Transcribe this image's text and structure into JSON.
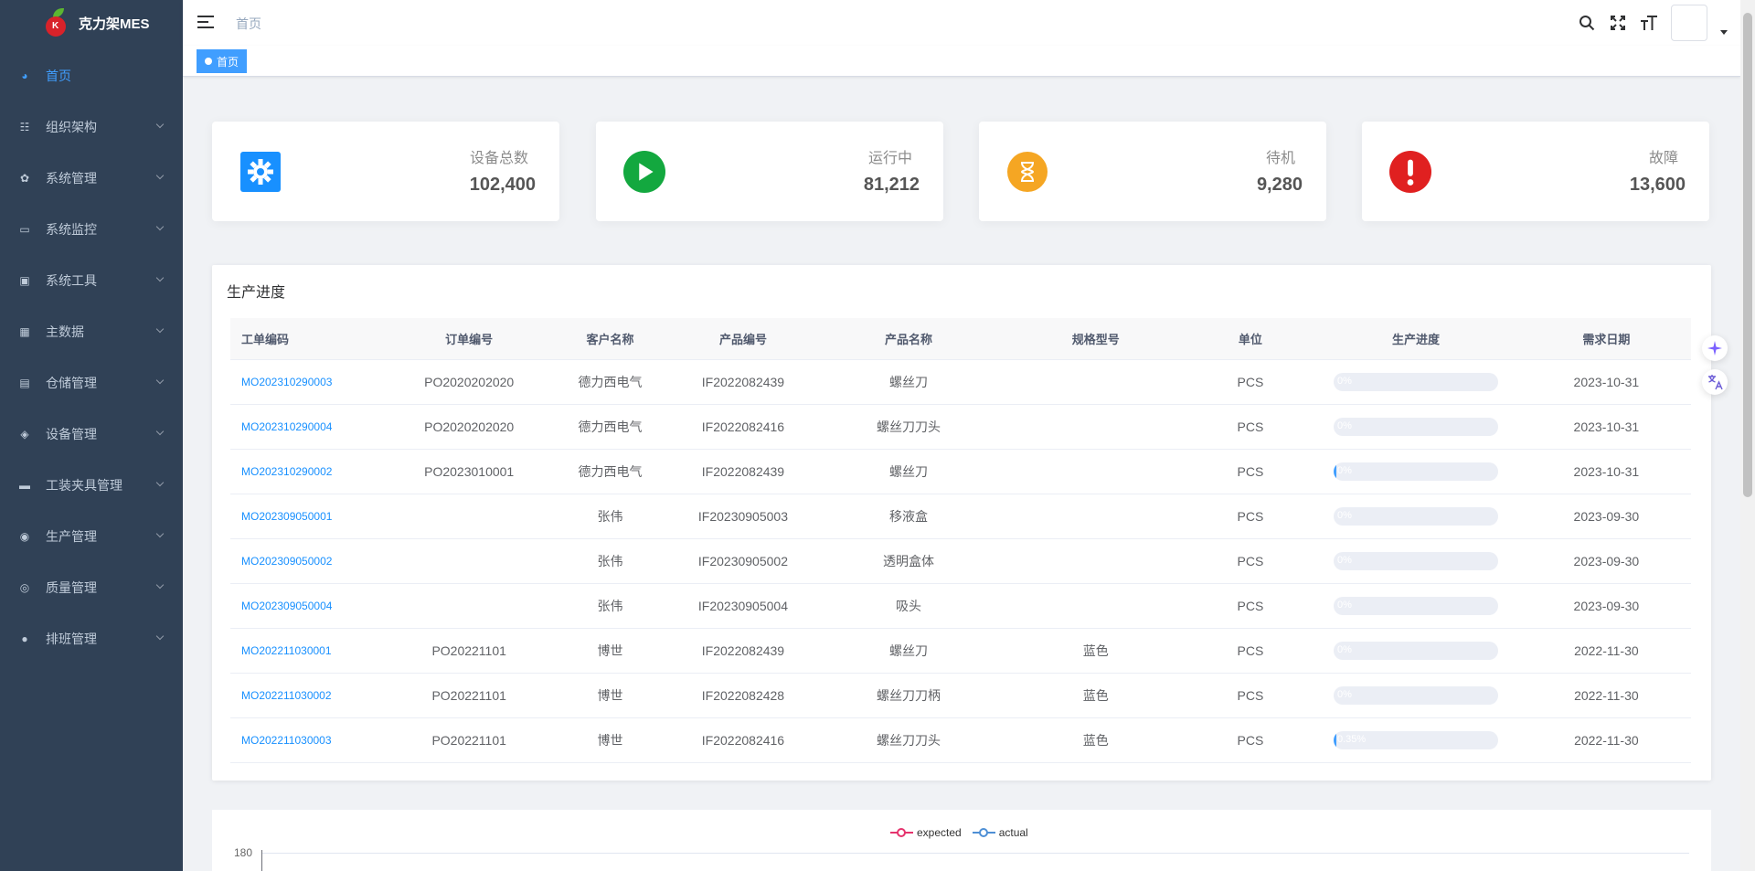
{
  "app": {
    "title": "克力架MES"
  },
  "sidebar": {
    "items": [
      {
        "label": "首页",
        "active": true
      },
      {
        "label": "组织架构"
      },
      {
        "label": "系统管理"
      },
      {
        "label": "系统监控"
      },
      {
        "label": "系统工具"
      },
      {
        "label": "主数据"
      },
      {
        "label": "仓储管理"
      },
      {
        "label": "设备管理"
      },
      {
        "label": "工装夹具管理"
      },
      {
        "label": "生产管理"
      },
      {
        "label": "质量管理"
      },
      {
        "label": "排班管理"
      }
    ]
  },
  "header": {
    "breadcrumb": "首页"
  },
  "tags": {
    "current": "首页"
  },
  "stats": [
    {
      "label": "设备总数",
      "value": "102,400",
      "icon": "gear-icon",
      "color": "#1890ff"
    },
    {
      "label": "运行中",
      "value": "81,212",
      "icon": "play-icon",
      "color": "#13a83f"
    },
    {
      "label": "待机",
      "value": "9,280",
      "icon": "hourglass-icon",
      "color": "#f5a623"
    },
    {
      "label": "故障",
      "value": "13,600",
      "icon": "exclamation-icon",
      "color": "#e02020"
    }
  ],
  "production": {
    "title": "生产进度",
    "columns": [
      "工单编码",
      "订单编号",
      "客户名称",
      "产品编号",
      "产品名称",
      "规格型号",
      "单位",
      "生产进度",
      "需求日期"
    ],
    "rows": [
      {
        "code": "MO202310290003",
        "order": "PO2020202020",
        "customer": "德力西电气",
        "product_code": "IF2022082439",
        "product_name": "螺丝刀",
        "spec": "",
        "unit": "PCS",
        "progress": "0%",
        "progress_value": 0,
        "date": "2023-10-31"
      },
      {
        "code": "MO202310290004",
        "order": "PO2020202020",
        "customer": "德力西电气",
        "product_code": "IF2022082416",
        "product_name": "螺丝刀刀头",
        "spec": "",
        "unit": "PCS",
        "progress": "0%",
        "progress_value": 0,
        "date": "2023-10-31"
      },
      {
        "code": "MO202310290002",
        "order": "PO2023010001",
        "customer": "德力西电气",
        "product_code": "IF2022082439",
        "product_name": "螺丝刀",
        "spec": "",
        "unit": "PCS",
        "progress": "0%",
        "progress_value": 1,
        "date": "2023-10-31"
      },
      {
        "code": "MO202309050001",
        "order": "",
        "customer": "张伟",
        "product_code": "IF20230905003",
        "product_name": "移液盒",
        "spec": "",
        "unit": "PCS",
        "progress": "0%",
        "progress_value": 0,
        "date": "2023-09-30"
      },
      {
        "code": "MO202309050002",
        "order": "",
        "customer": "张伟",
        "product_code": "IF20230905002",
        "product_name": "透明盒体",
        "spec": "",
        "unit": "PCS",
        "progress": "0%",
        "progress_value": 0,
        "date": "2023-09-30"
      },
      {
        "code": "MO202309050004",
        "order": "",
        "customer": "张伟",
        "product_code": "IF20230905004",
        "product_name": "吸头",
        "spec": "",
        "unit": "PCS",
        "progress": "0%",
        "progress_value": 0,
        "date": "2023-09-30"
      },
      {
        "code": "MO202211030001",
        "order": "PO20221101",
        "customer": "博世",
        "product_code": "IF2022082439",
        "product_name": "螺丝刀",
        "spec": "蓝色",
        "unit": "PCS",
        "progress": "0%",
        "progress_value": 0,
        "date": "2022-11-30"
      },
      {
        "code": "MO202211030002",
        "order": "PO20221101",
        "customer": "博世",
        "product_code": "IF2022082428",
        "product_name": "螺丝刀刀柄",
        "spec": "蓝色",
        "unit": "PCS",
        "progress": "0%",
        "progress_value": 0,
        "date": "2022-11-30"
      },
      {
        "code": "MO202211030003",
        "order": "PO20221101",
        "customer": "博世",
        "product_code": "IF2022082416",
        "product_name": "螺丝刀刀头",
        "spec": "蓝色",
        "unit": "PCS",
        "progress": "0.35%",
        "progress_value": 0.35,
        "date": "2022-11-30"
      }
    ]
  },
  "chart": {
    "legend": [
      {
        "name": "expected",
        "color": "#e5336d"
      },
      {
        "name": "actual",
        "color": "#4e8fd5"
      }
    ],
    "y_top": "180"
  }
}
